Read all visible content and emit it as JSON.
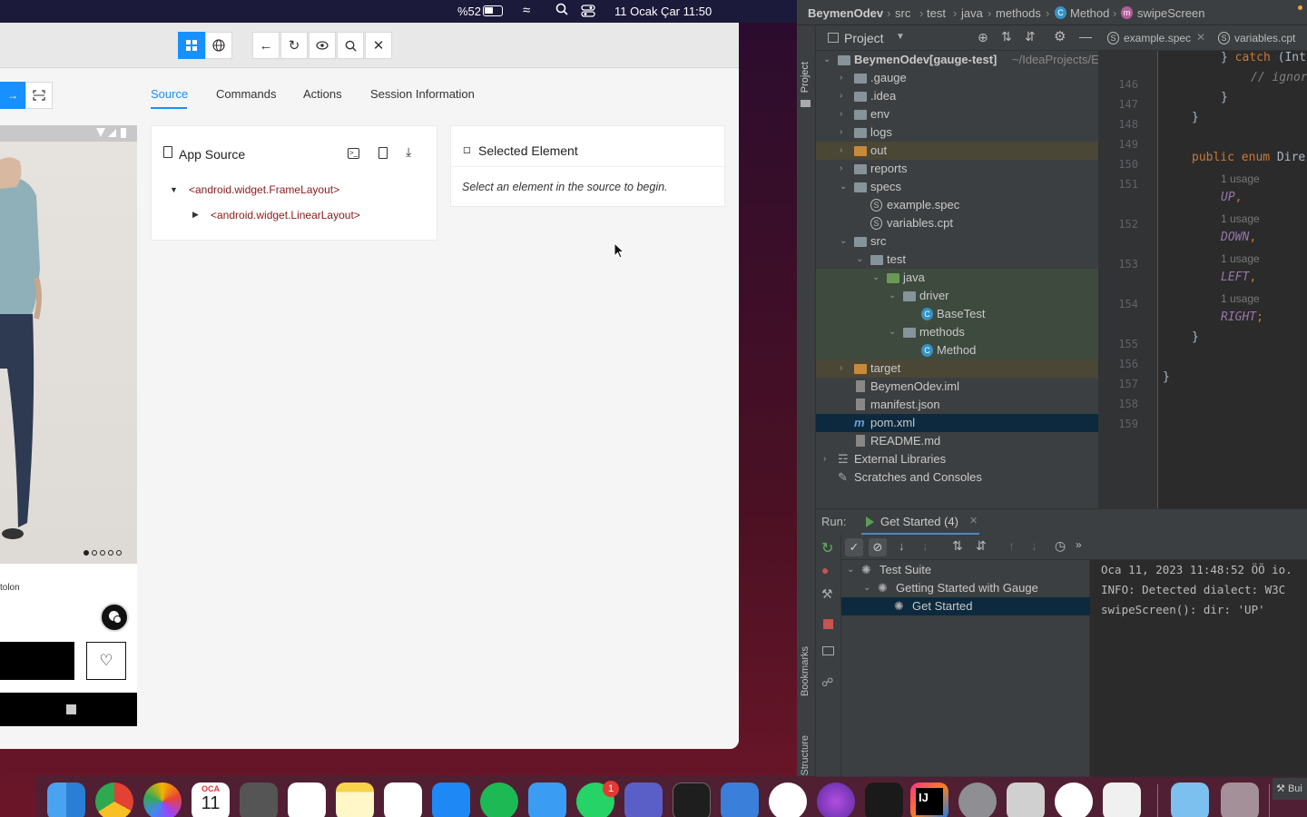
{
  "menubar": {
    "battery": "%52",
    "datetime": "11 Ocak Çar  11:50"
  },
  "appium": {
    "tabs": [
      {
        "label": "Source"
      },
      {
        "label": "Commands"
      },
      {
        "label": "Actions"
      },
      {
        "label": "Session Information"
      }
    ],
    "active_tab": "Source",
    "app_source": {
      "title": "App Source",
      "nodes": [
        {
          "text": "<android.widget.FrameLayout>"
        },
        {
          "text": "<android.widget.LinearLayout>"
        }
      ]
    },
    "selected_element": {
      "title": "Selected Element",
      "placeholder": "Select an element in the source to begin."
    },
    "phone": {
      "product_text": "tolon"
    }
  },
  "ide": {
    "breadcrumb": [
      "BeymenOdev",
      "src",
      "test",
      "java",
      "methods",
      "Method",
      "swipeScreen"
    ],
    "project_label": "Project",
    "side_labels": {
      "project": "Project",
      "bookmarks": "Bookmarks",
      "structure": "Structure"
    },
    "editor_tabs": [
      {
        "label": "example.spec"
      },
      {
        "label": "variables.cpt"
      }
    ],
    "tree": [
      {
        "label": "BeymenOdev",
        "extra": "[gauge-test]",
        "path": "~/IdeaProjects/E"
      },
      {
        "label": ".gauge"
      },
      {
        "label": ".idea"
      },
      {
        "label": "env"
      },
      {
        "label": "logs"
      },
      {
        "label": "out"
      },
      {
        "label": "reports"
      },
      {
        "label": "specs"
      },
      {
        "label": "example.spec"
      },
      {
        "label": "variables.cpt"
      },
      {
        "label": "src"
      },
      {
        "label": "test"
      },
      {
        "label": "java"
      },
      {
        "label": "driver"
      },
      {
        "label": "BaseTest"
      },
      {
        "label": "methods"
      },
      {
        "label": "Method"
      },
      {
        "label": "target"
      },
      {
        "label": "BeymenOdev.iml"
      },
      {
        "label": "manifest.json"
      },
      {
        "label": "pom.xml"
      },
      {
        "label": "README.md"
      },
      {
        "label": "External Libraries"
      },
      {
        "label": "Scratches and Consoles"
      }
    ],
    "line_numbers": [
      "146",
      "147",
      "148",
      "149",
      "150",
      "151",
      "152",
      "153",
      "154",
      "155",
      "156",
      "157",
      "158",
      "159"
    ],
    "code": {
      "l146a": "} ",
      "l146b": "catch",
      "l146c": " (Int",
      "l147": "// ignor",
      "l148": "}",
      "l149": "}",
      "l151a": "public enum",
      "l151b": " Dire",
      "usage": "1 usage",
      "up": "UP",
      "down": "DOWN",
      "left": "LEFT",
      "right": "RIGHT",
      "l156": "}",
      "l158": "}"
    },
    "run": {
      "label": "Run:",
      "config": "Get Started (4)",
      "tree": [
        {
          "label": "Test Suite"
        },
        {
          "label": "Getting Started with Gauge"
        },
        {
          "label": "Get Started"
        }
      ],
      "console": [
        "Oca 11, 2023 11:48:52 ÖÖ io.",
        "INFO: Detected dialect: W3C",
        "swipeScreen(): dir: 'UP'"
      ]
    }
  },
  "dock": {
    "calendar_month": "OCA",
    "calendar_day": "11",
    "whatsapp_badge": "1",
    "build_label": "Bui"
  }
}
